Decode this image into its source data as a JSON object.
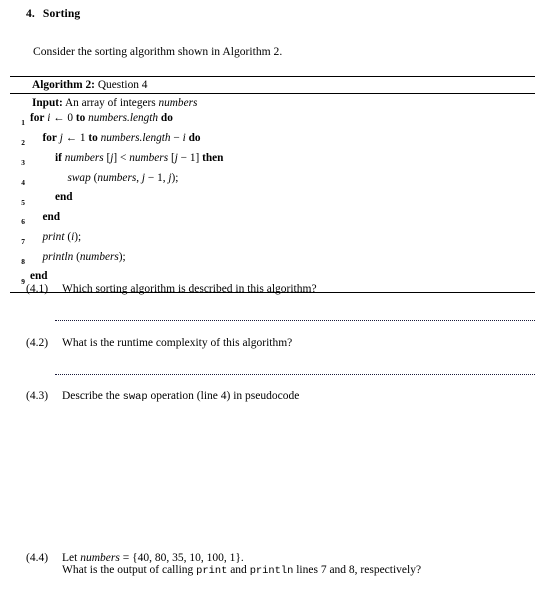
{
  "section": {
    "number": "4.",
    "title": "Sorting",
    "intro": "Consider the sorting algorithm shown in Algorithm 2."
  },
  "algorithm": {
    "caption_bold": "Algorithm 2:",
    "caption_rest": "Question 4",
    "input_label": "Input:",
    "input_text_a": "An array of integers",
    "input_var": "numbers",
    "lines": [
      {
        "no": "1",
        "depth": 0,
        "tokens": [
          {
            "t": "for",
            "s": "kw"
          },
          {
            "t": "i",
            "s": "id"
          },
          {
            "t": "← 0",
            "s": "n"
          },
          {
            "t": "to",
            "s": "kw"
          },
          {
            "t": "numbers.length",
            "s": "id"
          },
          {
            "t": "do",
            "s": "kw"
          }
        ]
      },
      {
        "no": "2",
        "depth": 1,
        "tokens": [
          {
            "t": "for",
            "s": "kw"
          },
          {
            "t": "j",
            "s": "id"
          },
          {
            "t": "← 1",
            "s": "n"
          },
          {
            "t": "to",
            "s": "kw"
          },
          {
            "t": "numbers.length",
            "s": "id"
          },
          {
            "t": "−",
            "s": "n"
          },
          {
            "t": "i",
            "s": "id"
          },
          {
            "t": "do",
            "s": "kw"
          }
        ]
      },
      {
        "no": "3",
        "depth": 2,
        "tokens": [
          {
            "t": "if",
            "s": "kw"
          },
          {
            "t": "numbers",
            "s": "id"
          },
          {
            "t": "[",
            "s": "n"
          },
          {
            "t": "j",
            "s": "id"
          },
          {
            "t": "]",
            "s": "n"
          },
          {
            "t": "<",
            "s": "n"
          },
          {
            "t": "numbers",
            "s": "id"
          },
          {
            "t": "[",
            "s": "n"
          },
          {
            "t": "j",
            "s": "id"
          },
          {
            "t": "− 1]",
            "s": "n"
          },
          {
            "t": "then",
            "s": "kw"
          }
        ]
      },
      {
        "no": "4",
        "depth": 3,
        "tokens": [
          {
            "t": "swap",
            "s": "id"
          },
          {
            "t": "(",
            "s": "n"
          },
          {
            "t": "numbers",
            "s": "id"
          },
          {
            "t": ",",
            "s": "n"
          },
          {
            "t": "j",
            "s": "id"
          },
          {
            "t": "− 1,",
            "s": "n"
          },
          {
            "t": "j",
            "s": "id"
          },
          {
            "t": ");",
            "s": "n"
          }
        ]
      },
      {
        "no": "5",
        "depth": 2,
        "tokens": [
          {
            "t": "end",
            "s": "kw"
          }
        ]
      },
      {
        "no": "6",
        "depth": 1,
        "tokens": [
          {
            "t": "end",
            "s": "kw"
          }
        ]
      },
      {
        "no": "7",
        "depth": 1,
        "tokens": [
          {
            "t": "print",
            "s": "id"
          },
          {
            "t": "(",
            "s": "n"
          },
          {
            "t": "i",
            "s": "id"
          },
          {
            "t": ");",
            "s": "n"
          }
        ]
      },
      {
        "no": "8",
        "depth": 1,
        "tokens": [
          {
            "t": "println",
            "s": "id"
          },
          {
            "t": "(",
            "s": "n"
          },
          {
            "t": "numbers",
            "s": "id"
          },
          {
            "t": ");",
            "s": "n"
          }
        ]
      },
      {
        "no": "9",
        "depth": 0,
        "tokens": [
          {
            "t": "end",
            "s": "kw"
          }
        ]
      }
    ]
  },
  "questions": {
    "q41": {
      "label": "(4.1)",
      "text": "Which sorting algorithm is described in this algorithm?"
    },
    "q42": {
      "label": "(4.2)",
      "text": "What is the runtime complexity of this algorithm?"
    },
    "q43": {
      "label": "(4.3)",
      "pre": "Describe the",
      "mono": "swap",
      "post": "operation (line 4) in pseudocode"
    },
    "q44": {
      "label": "(4.4)",
      "l1_pre": "Let",
      "l1_var": "numbers",
      "l1_post": "= {40, 80, 35, 10, 100, 1}.",
      "l2_a": "What is the output of calling",
      "l2_mono1": "print",
      "l2_b": "and",
      "l2_mono2": "println",
      "l2_c": "lines 7 and 8, respectively?"
    }
  },
  "colors": {
    "text": "#000000",
    "rule": "#000000",
    "dots": "#1b1b3a"
  }
}
